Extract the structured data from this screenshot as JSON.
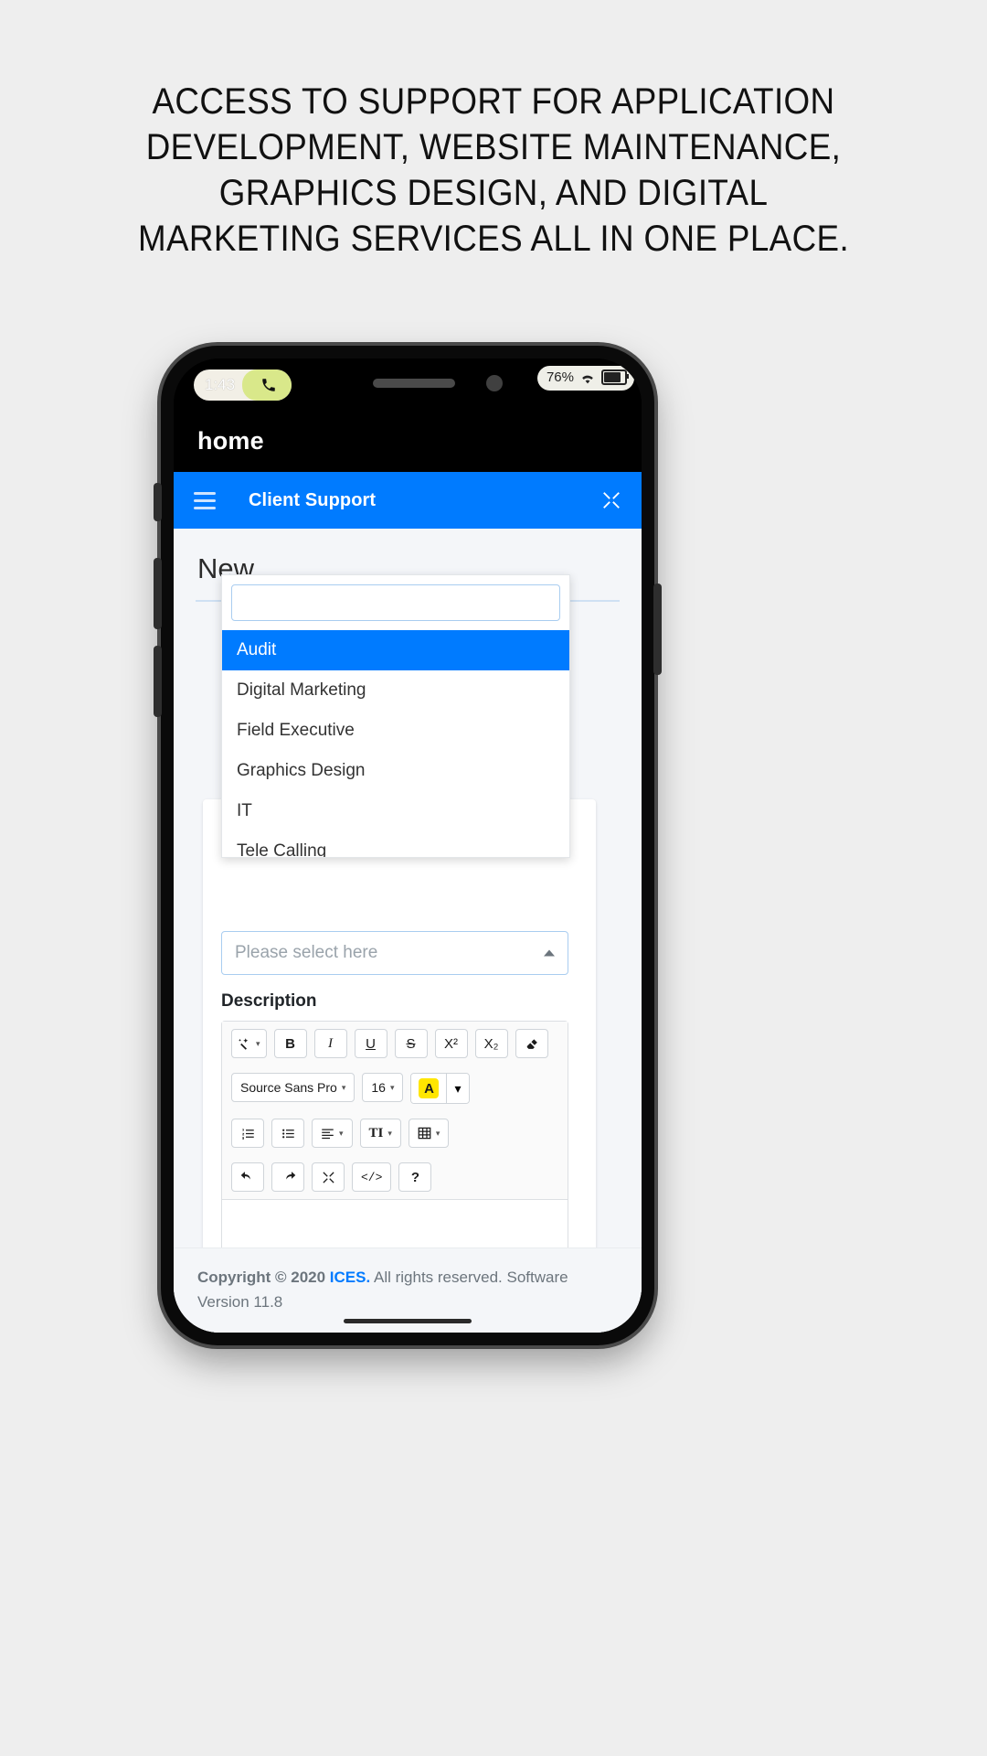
{
  "headline": {
    "lines": [
      "ACCESS TO SUPPORT FOR APPLICATION",
      "DEVELOPMENT, WEBSITE MAINTENANCE,",
      "GRAPHICS DESIGN, AND DIGITAL",
      "MARKETING SERVICES ALL IN ONE PLACE."
    ]
  },
  "phone": {
    "statusbar": {
      "time": "1:43",
      "call_icon": "phone-call-icon",
      "battery_percent": "76%",
      "wifi_icon": "wifi-icon",
      "battery_icon": "battery-icon"
    },
    "browser_title": "home"
  },
  "app": {
    "appbar": {
      "menu_icon": "hamburger-menu-icon",
      "title": "Client Support",
      "expand_icon": "expand-fullscreen-icon"
    },
    "page_heading": "New",
    "dropdown": {
      "search_value": "",
      "search_placeholder": "",
      "items": [
        "Audit",
        "Digital Marketing",
        "Field Executive",
        "Graphics Design",
        "IT",
        "Tele Calling"
      ],
      "selected_index": 0
    },
    "select": {
      "placeholder": "Please select here",
      "caret_icon": "caret-up-icon"
    },
    "description": {
      "label": "Description",
      "toolbar": {
        "row1": [
          {
            "name": "magic-wand-icon",
            "label": "✨",
            "caret": true
          },
          {
            "name": "bold-button",
            "label": "B"
          },
          {
            "name": "italic-button",
            "label": "I"
          },
          {
            "name": "underline-button",
            "label": "U"
          },
          {
            "name": "strikethrough-button",
            "label": "S"
          },
          {
            "name": "superscript-button",
            "label": "X²"
          },
          {
            "name": "subscript-button",
            "label": "X₂"
          },
          {
            "name": "eraser-button",
            "label": "⌧"
          }
        ],
        "font_family": "Source Sans Pro",
        "font_size": "16",
        "font_color_letter": "A",
        "row3": [
          {
            "name": "ordered-list-button",
            "label": "☰"
          },
          {
            "name": "unordered-list-button",
            "label": "☷"
          },
          {
            "name": "align-button",
            "label": "≡",
            "caret": true
          },
          {
            "name": "paragraph-style-button",
            "label": "TI",
            "caret": true
          },
          {
            "name": "table-button",
            "label": "▦",
            "caret": true
          }
        ],
        "row4": [
          {
            "name": "undo-button",
            "label": "↶"
          },
          {
            "name": "redo-button",
            "label": "↷"
          },
          {
            "name": "fullscreen-button",
            "label": "⤢"
          },
          {
            "name": "code-view-button",
            "label": "</>"
          },
          {
            "name": "help-button",
            "label": "?"
          }
        ]
      },
      "content": ""
    },
    "footer": {
      "copyright_prefix": "Copyright © 2020 ",
      "brand": "ICES.",
      "copyright_suffix": " All rights reserved. Software Version 11.8"
    }
  },
  "colors": {
    "accent_blue": "#007bff",
    "page_bg": "#eeeeee",
    "webview_bg": "#f4f6f9",
    "highlight_yellow": "#ffe600"
  }
}
